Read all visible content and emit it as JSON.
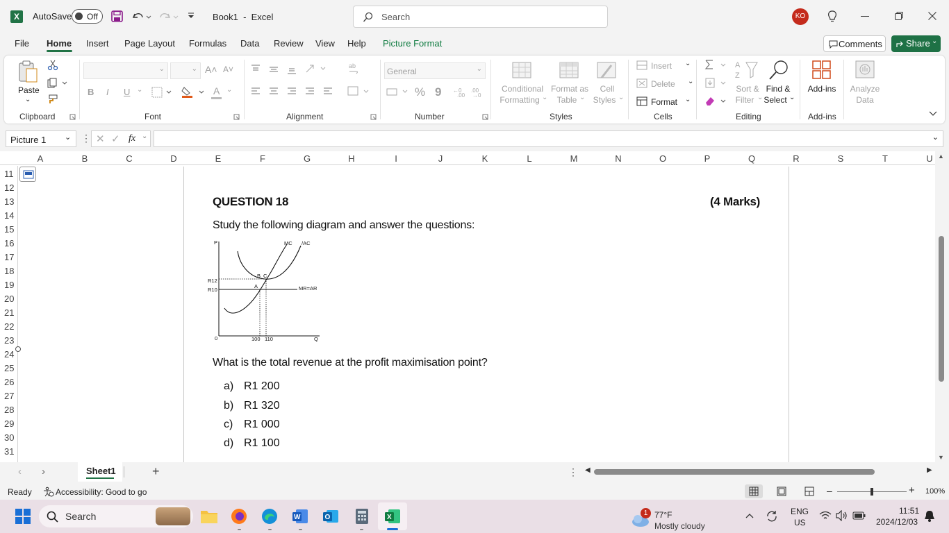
{
  "app": {
    "logo_letter": "X",
    "autosave_label": "AutoSave",
    "autosave_state": "Off",
    "title": "Book1  -  Excel",
    "search_placeholder": "Search",
    "user_initials": "KO"
  },
  "tabs": [
    "File",
    "Home",
    "Insert",
    "Page Layout",
    "Formulas",
    "Data",
    "Review",
    "View",
    "Help",
    "Picture Format"
  ],
  "active_tab": "Home",
  "comments_label": "Comments",
  "share_label": "Share",
  "ribbon": {
    "clipboard": {
      "paste": "Paste",
      "label": "Clipboard"
    },
    "font": {
      "label": "Font",
      "bold": "B",
      "italic": "I",
      "underline": "U",
      "grow": "A˄",
      "shrink": "A˅",
      "font_color": "A"
    },
    "alignment": {
      "label": "Alignment"
    },
    "number": {
      "format": "General",
      "label": "Number",
      "percent": "%",
      "comma": "9"
    },
    "styles": {
      "label": "Styles",
      "conditional": [
        "Conditional",
        "Formatting"
      ],
      "format_as_table": [
        "Format as",
        "Table"
      ],
      "cell_styles": [
        "Cell",
        "Styles"
      ]
    },
    "cells": {
      "label": "Cells",
      "insert": "Insert",
      "delete": "Delete",
      "format": "Format"
    },
    "editing": {
      "label": "Editing",
      "sort": [
        "Sort &",
        "Filter"
      ],
      "find": [
        "Find &",
        "Select"
      ]
    },
    "addins": {
      "label": "Add-ins",
      "addins": "Add-ins",
      "analyze": [
        "Analyze",
        "Data"
      ]
    }
  },
  "namebox": "Picture 1",
  "fx": "fx",
  "columns": [
    "A",
    "B",
    "C",
    "D",
    "E",
    "F",
    "G",
    "H",
    "I",
    "J",
    "K",
    "L",
    "M",
    "N",
    "O",
    "P",
    "Q",
    "R",
    "S",
    "T",
    "U"
  ],
  "rows": [
    "11",
    "12",
    "13",
    "14",
    "15",
    "16",
    "17",
    "18",
    "19",
    "20",
    "21",
    "22",
    "23",
    "24",
    "25",
    "26",
    "27",
    "28",
    "29",
    "30",
    "31"
  ],
  "picture": {
    "question_title": "QUESTION 18",
    "marks": "(4 Marks)",
    "instruction": "Study the following diagram and answer the questions:",
    "diagram": {
      "y_axis": "P",
      "x_axis": "Q",
      "origin": "0",
      "mc": "MC",
      "ac": "/AC",
      "mr_ar": "MR=AR",
      "r12": "R12",
      "r10": "R10",
      "pt_a": "A",
      "pt_b": "B",
      "pt_c": "C",
      "q100": "100",
      "q110": "110"
    },
    "prompt": "What is the total revenue at the profit maximisation point?",
    "options": [
      {
        "letter": "a)",
        "text": "R1 200"
      },
      {
        "letter": "b)",
        "text": "R1 320"
      },
      {
        "letter": "c)",
        "text": "R1 000"
      },
      {
        "letter": "d)",
        "text": "R1 100"
      }
    ]
  },
  "sheet_tab": "Sheet1",
  "status": {
    "ready": "Ready",
    "accessibility": "Accessibility: Good to go",
    "zoom": "100%"
  },
  "taskbar": {
    "search": "Search",
    "weather_badge": "1",
    "temp": "77°F",
    "weather": "Mostly cloudy",
    "lang1": "ENG",
    "lang2": "US",
    "time": "11:51",
    "date": "2024/12/03"
  },
  "colors": {
    "excel_green": "#217346",
    "share_green": "#1e7145",
    "picture_format": "#107c41",
    "avatar": "#c42b1c"
  }
}
